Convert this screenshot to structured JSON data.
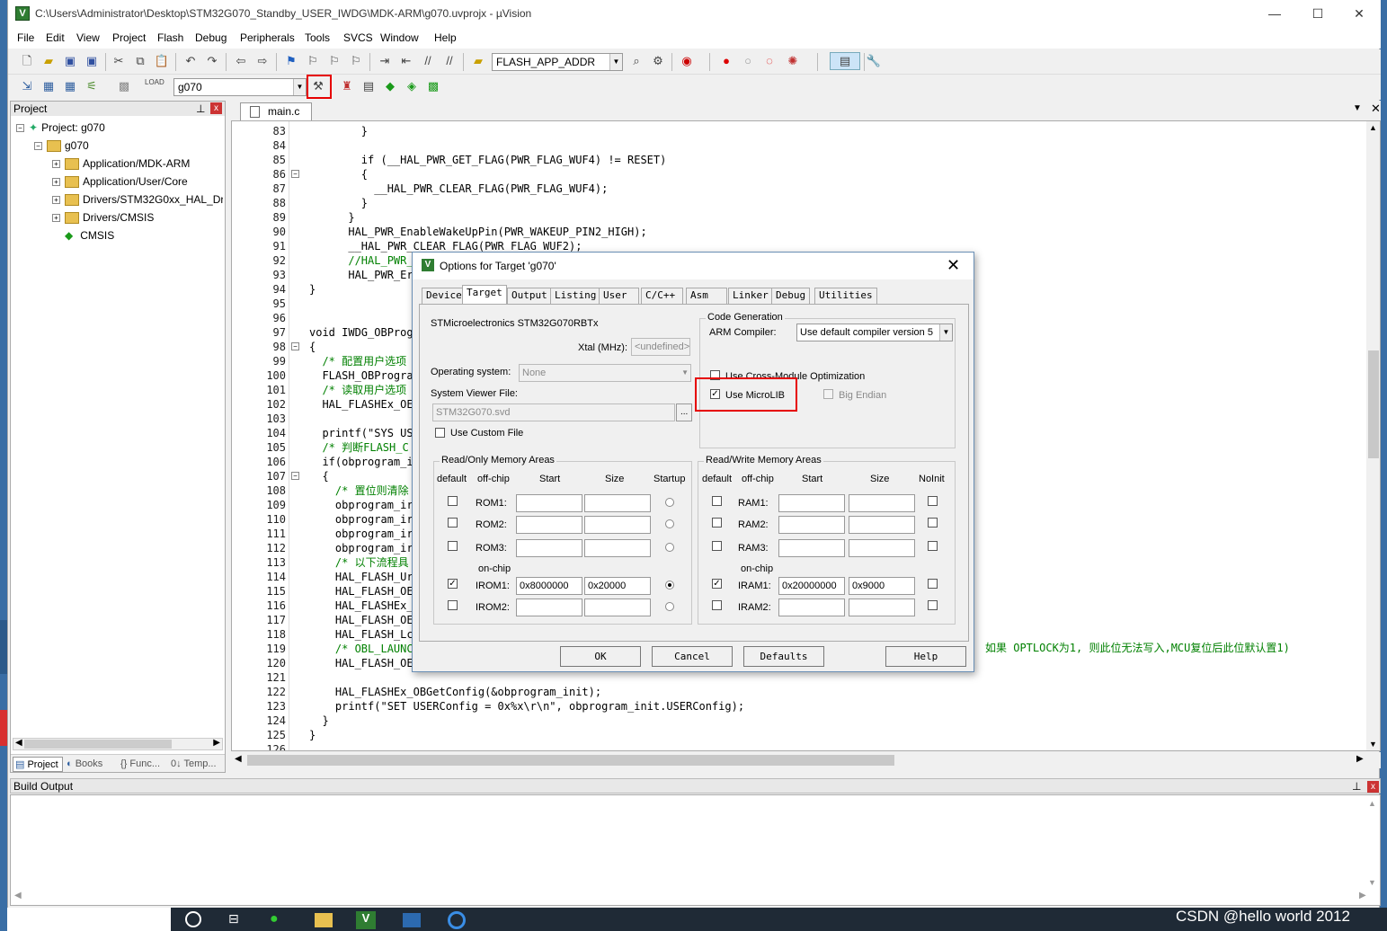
{
  "window": {
    "title": "C:\\Users\\Administrator\\Desktop\\STM32G070_Standby_USER_IWDG\\MDK-ARM\\g070.uvprojx - µVision",
    "minimize": "—",
    "maximize": "☐",
    "close": "✕"
  },
  "menu": [
    "File",
    "Edit",
    "View",
    "Project",
    "Flash",
    "Debug",
    "Peripherals",
    "Tools",
    "SVCS",
    "Window",
    "Help"
  ],
  "toolbar": {
    "search_combo": "FLASH_APP_ADDR",
    "target_combo": "g070"
  },
  "project_panel": {
    "title": "Project",
    "root": "Project: g070",
    "target": "g070",
    "groups": [
      "Application/MDK-ARM",
      "Application/User/Core",
      "Drivers/STM32G0xx_HAL_Dri",
      "Drivers/CMSIS",
      "CMSIS"
    ],
    "tabs": [
      "Project",
      "Books",
      "{} Func...",
      "0↓ Temp..."
    ]
  },
  "editor": {
    "tab": "main.c",
    "lines": [
      {
        "n": "83",
        "t": "        }"
      },
      {
        "n": "84",
        "t": ""
      },
      {
        "n": "85",
        "t": "        if (__HAL_PWR_GET_FLAG(PWR_FLAG_WUF4) != RESET)"
      },
      {
        "n": "86",
        "t": "        {"
      },
      {
        "n": "87",
        "t": "          __HAL_PWR_CLEAR_FLAG(PWR_FLAG_WUF4);"
      },
      {
        "n": "88",
        "t": "        }"
      },
      {
        "n": "89",
        "t": "      }"
      },
      {
        "n": "90",
        "t": "      HAL_PWR_EnableWakeUpPin(PWR_WAKEUP_PIN2_HIGH);"
      },
      {
        "n": "91",
        "t": "      __HAL_PWR_CLEAR_FLAG(PWR_FLAG_WUF2);"
      },
      {
        "n": "92",
        "t": "      //HAL_PWR_"
      },
      {
        "n": "93",
        "t": "      HAL_PWR_Er"
      },
      {
        "n": "94",
        "t": "}"
      },
      {
        "n": "95",
        "t": ""
      },
      {
        "n": "96",
        "t": ""
      },
      {
        "n": "97",
        "t": "void IWDG_OBProg"
      },
      {
        "n": "98",
        "t": "{"
      },
      {
        "n": "99",
        "t": "  /* 配置用户选项"
      },
      {
        "n": "100",
        "t": "  FLASH_OBProgra"
      },
      {
        "n": "101",
        "t": "  /* 读取用户选项"
      },
      {
        "n": "102",
        "t": "  HAL_FLASHEx_OE"
      },
      {
        "n": "103",
        "t": ""
      },
      {
        "n": "104",
        "t": "  printf(\"SYS US"
      },
      {
        "n": "105",
        "t": "  /* 判断FLASH_C"
      },
      {
        "n": "106",
        "t": "  if(obprogram_i"
      },
      {
        "n": "107",
        "t": "  {"
      },
      {
        "n": "108",
        "t": "    /* 置位则清除"
      },
      {
        "n": "109",
        "t": "    obprogram_ir"
      },
      {
        "n": "110",
        "t": "    obprogram_ir"
      },
      {
        "n": "111",
        "t": "    obprogram_ir"
      },
      {
        "n": "112",
        "t": "    obprogram_ir"
      },
      {
        "n": "113",
        "t": "    /* 以下流程具"
      },
      {
        "n": "114",
        "t": "    HAL_FLASH_Ur"
      },
      {
        "n": "115",
        "t": "    HAL_FLASH_OE"
      },
      {
        "n": "116",
        "t": "    HAL_FLASHEx_"
      },
      {
        "n": "117",
        "t": "    HAL_FLASH_OE"
      },
      {
        "n": "118",
        "t": "    HAL_FLASH_Lc"
      },
      {
        "n": "119",
        "t": "    /* OBL_LAUNC"
      },
      {
        "n": "120",
        "t": "    HAL_FLASH_OE"
      },
      {
        "n": "121",
        "t": ""
      },
      {
        "n": "122",
        "t": "    HAL_FLASHEx_OBGetConfig(&obprogram_init);"
      },
      {
        "n": "123",
        "t": "    printf(\"SET USERConfig = 0x%x\\r\\n\", obprogram_init.USERConfig);"
      },
      {
        "n": "124",
        "t": "  }"
      },
      {
        "n": "125",
        "t": "}"
      },
      {
        "n": "126",
        "t": ""
      }
    ],
    "overflow_comment": "如果 OPTLOCK为1, 则此位无法写入,MCU复位后此位默认置1)"
  },
  "build_output": {
    "title": "Build Output"
  },
  "dialog": {
    "title": "Options for Target 'g070'",
    "tabs": [
      "Device",
      "Target",
      "Output",
      "Listing",
      "User",
      "C/C++",
      "Asm",
      "Linker",
      "Debug",
      "Utilities"
    ],
    "device": "STMicroelectronics STM32G070RBTx",
    "xtal_label": "Xtal (MHz):",
    "xtal_value": "<undefined>",
    "os_label": "Operating system:",
    "os_value": "None",
    "svf_label": "System Viewer File:",
    "svf_value": "STM32G070.svd",
    "browse": "...",
    "use_custom_file": "Use Custom File",
    "code_gen": {
      "title": "Code Generation",
      "compiler_label": "ARM Compiler:",
      "compiler_value": "Use default compiler version 5",
      "cross_module": "Use Cross-Module Optimization",
      "microlib": "Use MicroLIB",
      "big_endian": "Big Endian"
    },
    "rom": {
      "title": "Read/Only Memory Areas",
      "headers": [
        "default",
        "off-chip",
        "Start",
        "Size",
        "Startup"
      ],
      "onchip": "on-chip",
      "rows": [
        {
          "name": "ROM1:",
          "start": "",
          "size": "",
          "default": false,
          "startup": false
        },
        {
          "name": "ROM2:",
          "start": "",
          "size": "",
          "default": false,
          "startup": false
        },
        {
          "name": "ROM3:",
          "start": "",
          "size": "",
          "default": false,
          "startup": false
        },
        {
          "name": "IROM1:",
          "start": "0x8000000",
          "size": "0x20000",
          "default": true,
          "startup": true
        },
        {
          "name": "IROM2:",
          "start": "",
          "size": "",
          "default": false,
          "startup": false
        }
      ]
    },
    "ram": {
      "title": "Read/Write Memory Areas",
      "headers": [
        "default",
        "off-chip",
        "Start",
        "Size",
        "NoInit"
      ],
      "onchip": "on-chip",
      "rows": [
        {
          "name": "RAM1:",
          "start": "",
          "size": "",
          "default": false
        },
        {
          "name": "RAM2:",
          "start": "",
          "size": "",
          "default": false
        },
        {
          "name": "RAM3:",
          "start": "",
          "size": "",
          "default": false
        },
        {
          "name": "IRAM1:",
          "start": "0x20000000",
          "size": "0x9000",
          "default": true
        },
        {
          "name": "IRAM2:",
          "start": "",
          "size": "",
          "default": false
        }
      ]
    },
    "buttons": {
      "ok": "OK",
      "cancel": "Cancel",
      "defaults": "Defaults",
      "help": "Help"
    },
    "check": "✓"
  },
  "watermark": "CSDN @hello world 2012",
  "colors": {
    "highlight": "#e60000",
    "keyword": "#0000ff",
    "comment": "#008000",
    "string": "#800080"
  }
}
